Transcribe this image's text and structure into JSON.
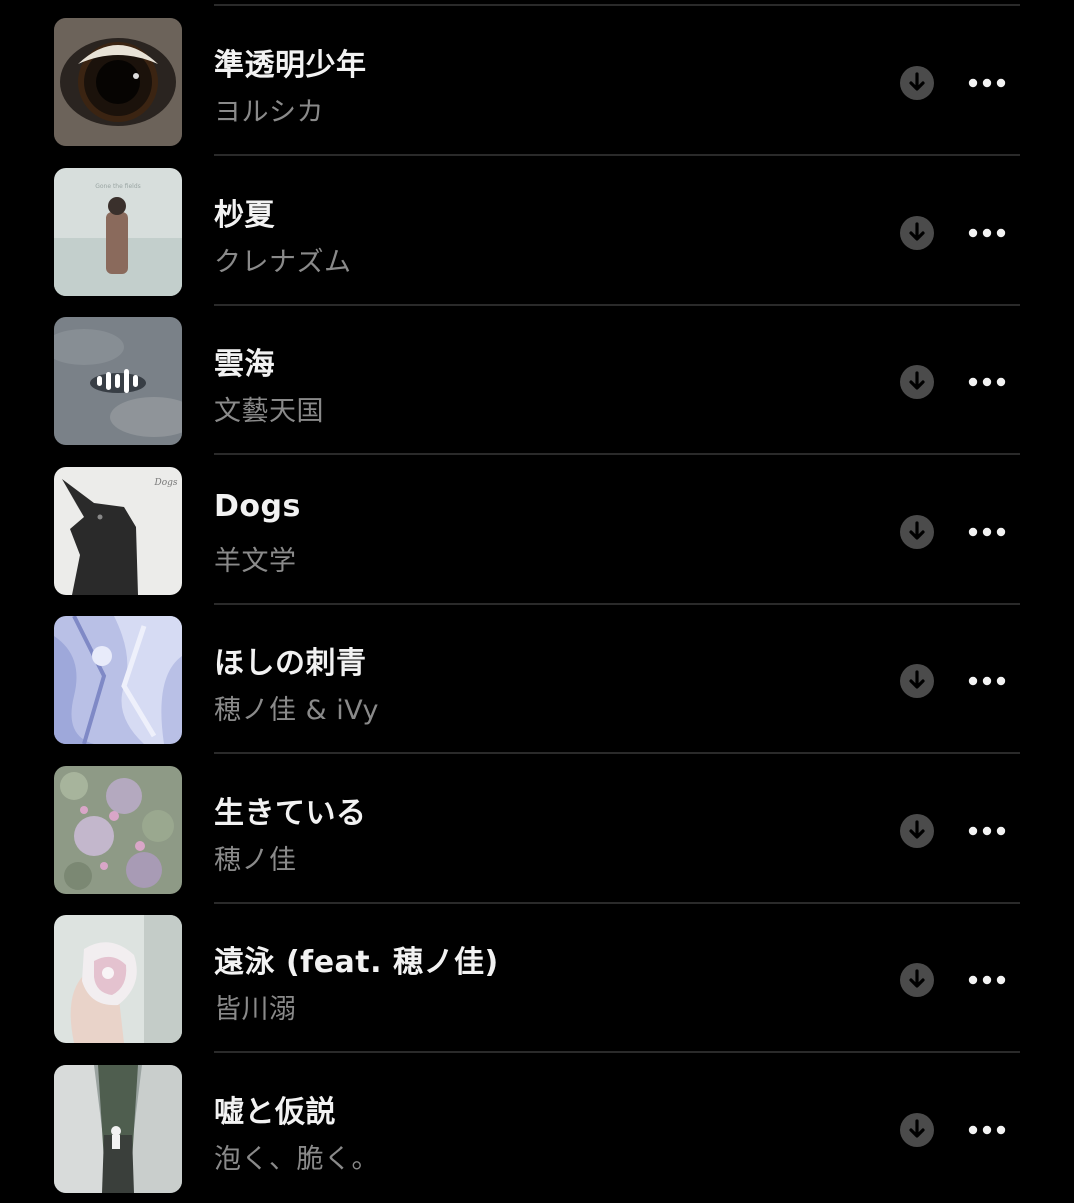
{
  "songs": [
    {
      "title": "準透明少年",
      "artist": "ヨルシカ",
      "artwork": "eye-closeup"
    },
    {
      "title": "杪夏",
      "artist": "クレナズム",
      "artwork": "figure-in-snow",
      "art_text": "Gone the fields"
    },
    {
      "title": "雲海",
      "artist": "文藝天国",
      "artwork": "cloud-sea",
      "now_playing": true
    },
    {
      "title": "Dogs",
      "artist": "羊文学",
      "artwork": "doberman",
      "art_text": "Dogs"
    },
    {
      "title": "ほしの刺青",
      "artist": "穂ノ佳 & iVy",
      "artwork": "icy-collage"
    },
    {
      "title": "生きている",
      "artist": "穂ノ佳",
      "artwork": "flower-field"
    },
    {
      "title": "遠泳 (feat. 穂ノ佳)",
      "artist": "皆川溺",
      "artwork": "hand-holding-crystal"
    },
    {
      "title": "嘘と仮説",
      "artist": "泡く、脆く。",
      "artwork": "station-stairs"
    }
  ],
  "icons": {
    "download": "download-circle-icon",
    "more": "more-ellipsis-icon",
    "now_playing": "equalizer-bars-icon"
  },
  "colors": {
    "background": "#000000",
    "title": "#f2f2f2",
    "artist": "#8a8a8a",
    "download_bg": "#4b4b4b",
    "separator": "#2a2a2a"
  }
}
